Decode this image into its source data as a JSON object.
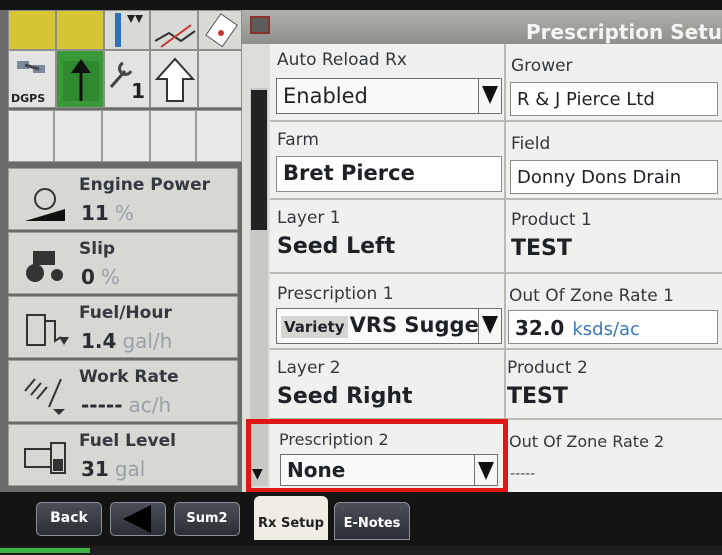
{
  "status_bar": {
    "gps_label": "DGPS",
    "wrench_count": "1"
  },
  "gauges": [
    {
      "label": "Engine Power",
      "value": "11",
      "unit": "%",
      "icon": "engine-icon"
    },
    {
      "label": "Slip",
      "value": "0",
      "unit": "%",
      "icon": "tractor-slip-icon"
    },
    {
      "label": "Fuel/Hour",
      "value": "1.4",
      "unit": "gal/h",
      "icon": "fuel-pump-icon"
    },
    {
      "label": "Work Rate",
      "value": "-----",
      "unit": "ac/h",
      "icon": "work-rate-icon"
    },
    {
      "label": "Fuel Level",
      "value": "31",
      "unit": "gal",
      "icon": "fuel-tank-icon"
    }
  ],
  "page": {
    "title": "Prescription Setu"
  },
  "fields": {
    "auto_reload_label": "Auto Reload Rx",
    "auto_reload_value": "Enabled",
    "grower_label": "Grower",
    "grower_value": "R & J Pierce Ltd",
    "farm_label": "Farm",
    "farm_value": "Bret Pierce",
    "field_label": "Field",
    "field_value": "Donny Dons Drain",
    "layer1_label": "Layer 1",
    "layer1_value": "Seed Left",
    "product1_label": "Product 1",
    "product1_value": "TEST",
    "prescription1_label": "Prescription 1",
    "prescription1_prefix": "Variety",
    "prescription1_value": "VRS Sugge",
    "ooz_rate1_label": "Out Of Zone Rate 1",
    "ooz_rate1_value": "32.0",
    "ooz_rate1_unit": "ksds/ac",
    "layer2_label": "Layer 2",
    "layer2_value": "Seed Right",
    "product2_label": "Product 2",
    "product2_value": "TEST",
    "prescription2_label": "Prescription 2",
    "prescription2_value": "None",
    "ooz_rate2_label": "Out Of Zone Rate 2",
    "ooz_rate2_value": "-----"
  },
  "nav": {
    "back_label": "Back",
    "sum2_label": "Sum2",
    "tab_rx_setup": "Rx Setup",
    "tab_enotes": "E-Notes"
  },
  "colors": {
    "highlight": "#e11717",
    "status_yellow": "#d8c536"
  }
}
